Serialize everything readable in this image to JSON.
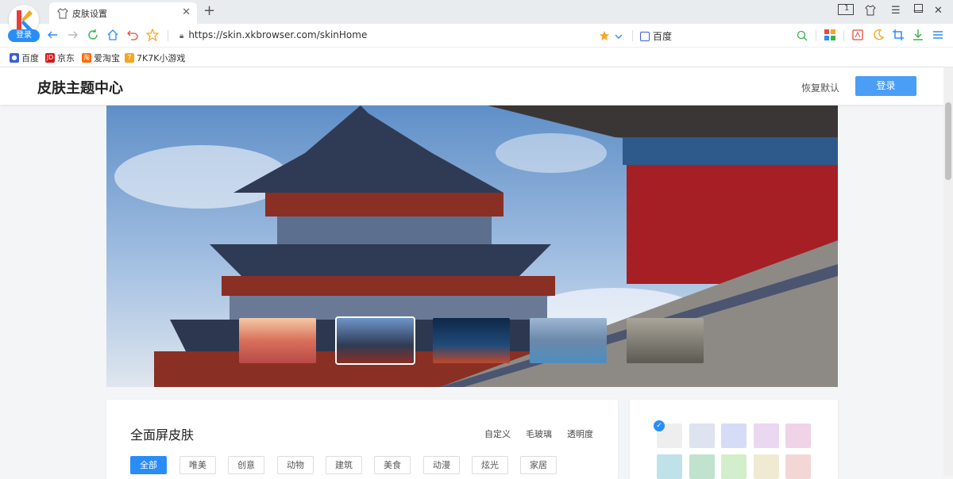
{
  "browser": {
    "logo_badge": "登录",
    "tab_title": "皮肤设置",
    "url": "https://skin.xkbrowser.com/skinHome",
    "search_engine": "百度",
    "tab_count": "1",
    "bookmarks": [
      {
        "label": "百度",
        "icon": "baidu-icon",
        "color": "#3a5fd6"
      },
      {
        "label": "京东",
        "icon": "jd-icon",
        "color": "#d21a1a"
      },
      {
        "label": "爱淘宝",
        "icon": "taobao-icon",
        "color": "#ff6a00"
      },
      {
        "label": "7K7K小游戏",
        "icon": "game-icon",
        "color": "#f5a623"
      }
    ]
  },
  "page": {
    "title": "皮肤主题中心",
    "reset_label": "恢复默认",
    "login_label": "登录"
  },
  "section": {
    "title": "全面屏皮肤",
    "options": [
      "自定义",
      "毛玻璃",
      "透明度"
    ],
    "categories": [
      "全部",
      "唯美",
      "创意",
      "动物",
      "建筑",
      "美食",
      "动漫",
      "炫光",
      "家居"
    ],
    "active_category": "全部"
  },
  "colors": {
    "accent": "#2a8df7",
    "swatches_row1": [
      "#eeeeee",
      "#dfe2ef",
      "#d6dbf6",
      "#ead7f0",
      "#f0d3e7"
    ],
    "swatches_row2": [
      "#bfe2e8",
      "#bfe3cf",
      "#d3eecb",
      "#f0ead2",
      "#f3d7d7"
    ]
  }
}
